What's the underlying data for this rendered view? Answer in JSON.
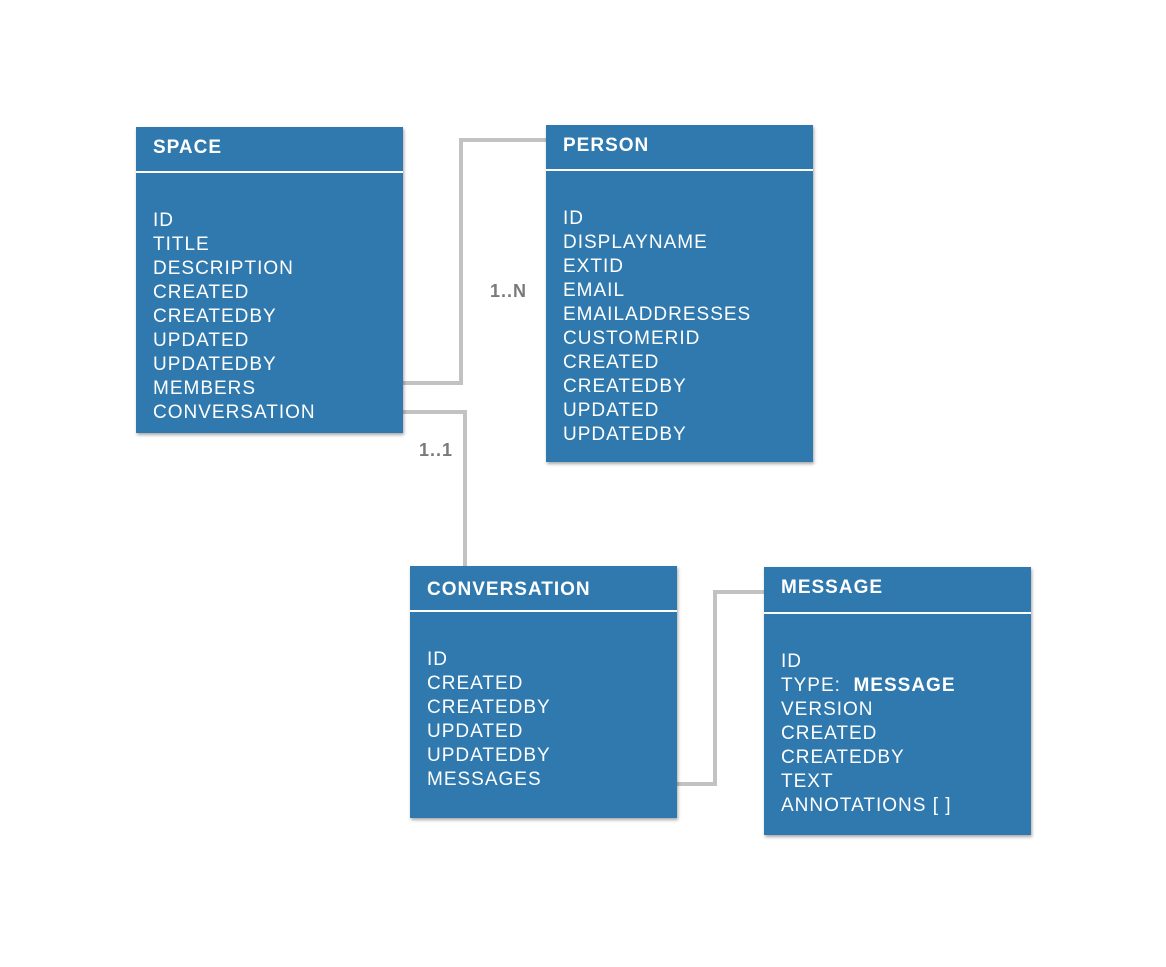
{
  "entities": {
    "space": {
      "title": "SPACE",
      "fields": [
        "ID",
        "TITLE",
        "DESCRIPTION",
        "CREATED",
        "CREATEDBY",
        "UPDATED",
        "UPDATEDBY",
        "MEMBERS",
        "CONVERSATION"
      ]
    },
    "person": {
      "title": "PERSON",
      "fields": [
        "ID",
        "DISPLAYNAME",
        "EXTID",
        "EMAIL",
        "EMAILADDRESSES",
        "CUSTOMERID",
        "CREATED",
        "CREATEDBY",
        "UPDATED",
        "UPDATEDBY"
      ]
    },
    "conversation": {
      "title": "CONVERSATION",
      "fields": [
        "ID",
        "CREATED",
        "CREATEDBY",
        "UPDATED",
        "UPDATEDBY",
        "MESSAGES"
      ]
    },
    "message": {
      "title": "MESSAGE",
      "fields": [
        "ID",
        "TYPE:",
        "VERSION",
        "CREATED",
        "CREATEDBY",
        "TEXT",
        "ANNOTATIONS [ ]"
      ],
      "type_value": "MESSAGE"
    }
  },
  "relationships": [
    {
      "from": "person",
      "to": "space.members",
      "cardinality": "1..N"
    },
    {
      "from": "conversation",
      "to": "space.conversation",
      "cardinality": "1..1"
    },
    {
      "from": "message",
      "to": "conversation.messages",
      "cardinality": ""
    }
  ],
  "colors": {
    "entity_fill": "#2f79ae",
    "entity_text": "#ffffff",
    "connector": "#c2c2c2",
    "cardinality_text": "#7a7a7a"
  }
}
